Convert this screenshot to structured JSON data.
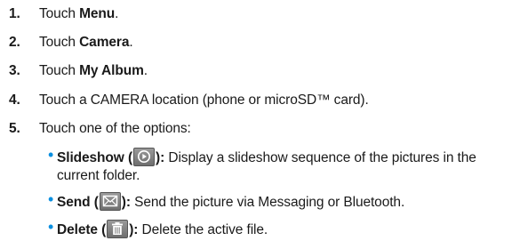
{
  "steps": [
    {
      "num": "1.",
      "pre": "Touch ",
      "bold": "Menu",
      "post": "."
    },
    {
      "num": "2.",
      "pre": "Touch ",
      "bold": "Camera",
      "post": "."
    },
    {
      "num": "3.",
      "pre": "Touch ",
      "bold": "My Album",
      "post": "."
    },
    {
      "num": "4.",
      "text": "Touch a CAMERA location (phone or microSD™ card)."
    },
    {
      "num": "5.",
      "text": "Touch one of the options:"
    }
  ],
  "options": [
    {
      "name": "Slideshow (",
      "close": "):",
      "icon": "play-circle-icon",
      "desc": " Display a slideshow sequence of the pictures in the current folder."
    },
    {
      "name": "Send (",
      "close": "):",
      "icon": "envelope-icon",
      "desc": " Send the picture via Messaging or Bluetooth."
    },
    {
      "name": "Delete (",
      "close": "):",
      "icon": "trash-icon",
      "desc": " Delete the active file."
    }
  ],
  "colors": {
    "bullet": "#0a8fe0",
    "icon_bg": "#7f7f7f"
  }
}
